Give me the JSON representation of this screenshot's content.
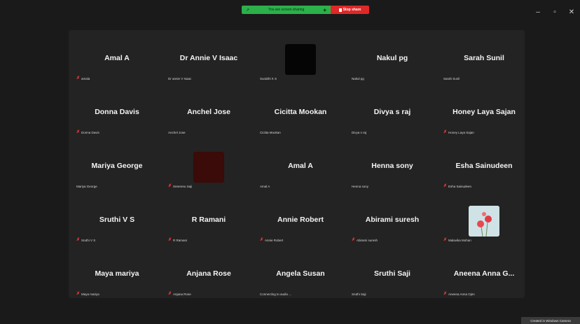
{
  "banner": {
    "sharing_text": "You are screen sharing",
    "stop_label": "Stop share"
  },
  "window": {
    "minimize": "–",
    "maximize": "▫",
    "close": "✕"
  },
  "tiles": [
    {
      "display": "Amal A",
      "label": "amala",
      "muted": true
    },
    {
      "display": "Dr Annie V Isaac",
      "label": "Dr annie V Isaac",
      "muted": false
    },
    {
      "display": "",
      "label": "Surabhi K S",
      "muted": false,
      "thumb": "black"
    },
    {
      "display": "Nakul pg",
      "label": "Nakul pg",
      "muted": false
    },
    {
      "display": "Sarah Sunil",
      "label": "Sarah Sunil",
      "muted": false
    },
    {
      "display": "Donna Davis",
      "label": "Donna Davis",
      "muted": true
    },
    {
      "display": "Anchel Jose",
      "label": "Anchel Jose",
      "muted": false
    },
    {
      "display": "Cicitta Mookan",
      "label": "Cicitta Mookan",
      "muted": false
    },
    {
      "display": "Divya s raj",
      "label": "Divya s raj",
      "muted": false
    },
    {
      "display": "Honey Laya Sajan",
      "label": "Honey Laya Sajan",
      "muted": true
    },
    {
      "display": "Mariya George",
      "label": "Mariya George",
      "muted": false
    },
    {
      "display": "",
      "label": "Sreerenu Saji",
      "muted": true,
      "thumb": "maroon"
    },
    {
      "display": "Amal A",
      "label": "Amal A",
      "muted": false
    },
    {
      "display": "Henna sony",
      "label": "Henna sony",
      "muted": false
    },
    {
      "display": "Esha Sainudeen",
      "label": "Esha Sainudeen",
      "muted": true
    },
    {
      "display": "Sruthi V S",
      "label": "Sruthi V S",
      "muted": true
    },
    {
      "display": "R Ramani",
      "label": "R Ramani",
      "muted": true
    },
    {
      "display": "Annie Robert",
      "label": "Annie Robert",
      "muted": true
    },
    {
      "display": "Abirami suresh",
      "label": "Abirami suresh",
      "muted": true
    },
    {
      "display": "",
      "label": "Malavika Mohan",
      "muted": true,
      "thumb": "flower"
    },
    {
      "display": "Maya mariya",
      "label": "Maya mariya",
      "muted": true
    },
    {
      "display": "Anjana Rose",
      "label": "Anjana Rose",
      "muted": true
    },
    {
      "display": "Angela Susan",
      "label": "Connecting to audio ...",
      "muted": false
    },
    {
      "display": "Sruthi Saji",
      "label": "Sruthi Saji",
      "muted": false
    },
    {
      "display": "Aneena Anna G...",
      "label": "Aneena Anna Ojen",
      "muted": true
    }
  ],
  "status_tip": "Created in Windows Camera",
  "colors": {
    "banner_green": "#2bb04a",
    "stop_red": "#e02828",
    "mic_muted": "#ff3b3b",
    "tile_bg": "#232323"
  }
}
